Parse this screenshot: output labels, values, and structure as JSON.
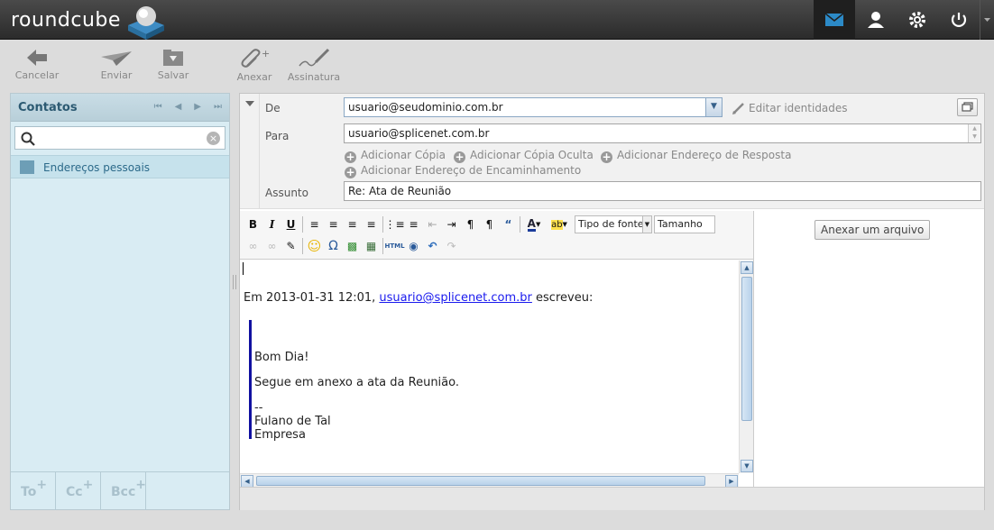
{
  "app": {
    "logo_text": "roundcube"
  },
  "topnav": {
    "items": [
      {
        "name": "mail",
        "active": true
      },
      {
        "name": "contacts"
      },
      {
        "name": "settings"
      },
      {
        "name": "logout"
      }
    ]
  },
  "toolbar": {
    "cancel": "Cancelar",
    "send": "Enviar",
    "save": "Salvar",
    "attach": "Anexar",
    "signature": "Assinatura"
  },
  "contacts": {
    "title": "Contatos",
    "search_placeholder": "",
    "address_book": "Endereços pessoais",
    "footer": [
      "To",
      "Cc",
      "Bcc"
    ]
  },
  "compose": {
    "from_label": "De",
    "from_value": "usuario@seudominio.com.br",
    "edit_identities": "Editar identidades",
    "to_label": "Para",
    "to_value": "usuario@splicenet.com.br",
    "add_cc": "Adicionar Cópia",
    "add_bcc": "Adicionar Cópia Oculta",
    "add_reply_to": "Adicionar Endereço de Resposta",
    "add_followup_to": "Adicionar Endereço de Encaminhamento",
    "subject_label": "Assunto",
    "subject_value": "Re: Ata de Reunião"
  },
  "editor": {
    "font_select": "Tipo de fonte",
    "size_select": "Tamanho",
    "body": {
      "quote_intro_prefix": "Em 2013-01-31 12:01, ",
      "quote_intro_link": "usuario@splicenet.com.br",
      "quote_intro_suffix": " escreveu:",
      "quoted_lines": [
        "Bom Dia!",
        "Segue em anexo a ata da Reunião.",
        "--",
        "Fulano de Tal",
        "Empresa"
      ]
    }
  },
  "attachments": {
    "button": "Anexar um arquivo"
  },
  "colors": {
    "topbar": "#2b2b2b",
    "accent": "#2c8ac7",
    "contacts_bg": "#d9ecf3",
    "quote_bar": "#1010a0"
  }
}
